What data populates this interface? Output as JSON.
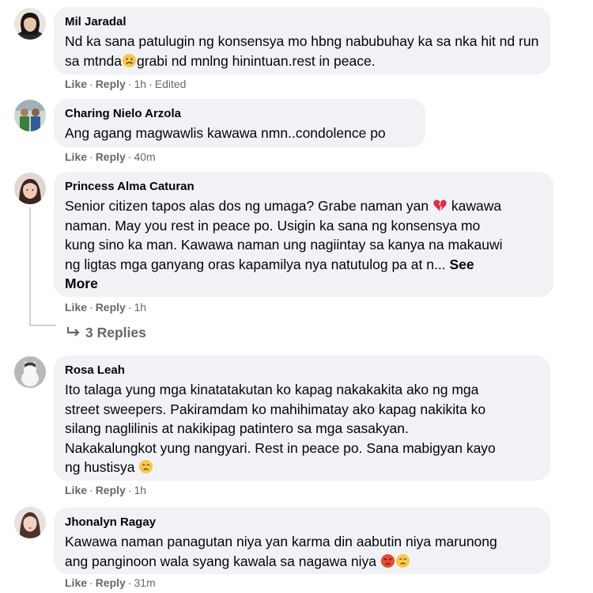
{
  "comments": [
    {
      "author": "Mil Jaradal",
      "text": "Nd ka sana patulugin ng konsensya mo hbng nabubuhay ka sa nka hit nd run sa mtnda",
      "text_after": "grabi nd mnlng hinintuan.rest in peace.",
      "emoji": "sad-face",
      "like": "Like",
      "reply": "Reply",
      "time": "1h",
      "edited": "Edited"
    },
    {
      "author": "Charing Nielo Arzola",
      "text": "Ang agang magwawlis kawawa nmn..condolence po",
      "like": "Like",
      "reply": "Reply",
      "time": "40m"
    },
    {
      "author": "Princess Alma Caturan",
      "line1": "Senior citizen tapos alas dos ng umaga? Grabe naman yan",
      "line1b": "kawawa",
      "line2": "naman. May you rest in peace po. Usigin ka sana ng konsensya mo",
      "line3": "kung sino ka man. Kawawa naman ung nagiintay sa kanya na makauwi",
      "line4": "ng ligtas mga ganyang oras kapamilya nya natutulog pa at n...",
      "see_more_1": "See",
      "see_more_2": "More",
      "emoji": "broken-heart",
      "like": "Like",
      "reply": "Reply",
      "time": "1h",
      "replies": "3 Replies"
    },
    {
      "author": "Rosa Leah",
      "line1": "Ito talaga yung mga kinatatakutan ko kapag nakakakita ako ng mga",
      "line2": "street sweepers. Pakiramdam ko mahihimatay ako kapag nakikita ko",
      "line3": "silang naglilinis at nakikipag patintero sa mga sasakyan.",
      "line4": "Nakakalungkot yung nangyari. Rest in peace po. Sana mabigyan kayo",
      "line5": "ng hustisya",
      "emoji": "worried-face",
      "like": "Like",
      "reply": "Reply",
      "time": "1h"
    },
    {
      "author": "Jhonalyn Ragay",
      "line1": "Kawawa naman panagutan niya yan karma din aabutin niya marunong",
      "line2": "ang panginoon wala syang kawala sa nagawa niya",
      "emoji": [
        "angry-face",
        "worried-face"
      ],
      "like": "Like",
      "reply": "Reply",
      "time": "31m"
    }
  ],
  "separator": "·",
  "colors": {
    "bubble": "#f0f2f5",
    "secondary_text": "#65676b",
    "primary_text": "#050505"
  }
}
